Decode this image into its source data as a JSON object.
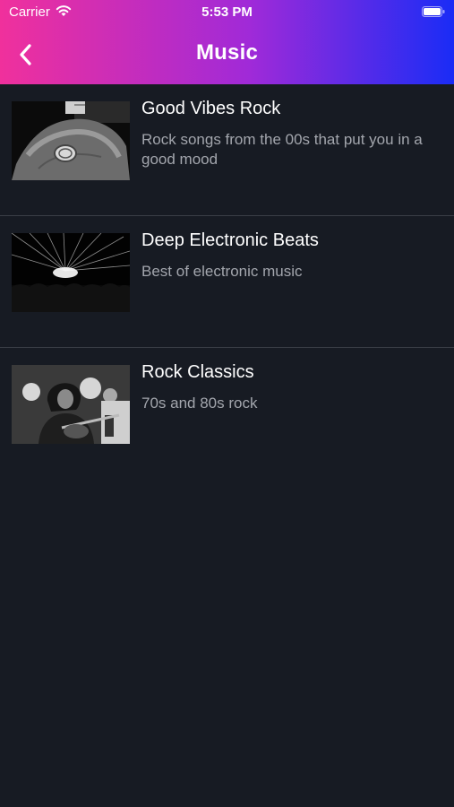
{
  "status_bar": {
    "carrier": "Carrier",
    "time": "5:53 PM"
  },
  "nav": {
    "title": "Music",
    "back_icon": "chevron-left-icon"
  },
  "colors": {
    "gradient_start": "#f0309c",
    "gradient_mid": "#a02ad8",
    "gradient_end": "#1a2cf6",
    "background": "#171b23",
    "divider": "#3a3e46",
    "secondary_text": "#a3a6ad"
  },
  "playlists": [
    {
      "title": "Good Vibes Rock",
      "description": "Rock songs from the 00s that put you in a good mood",
      "image": "hand-holding-coin-photo"
    },
    {
      "title": "Deep Electronic Beats",
      "description": "Best of electronic music",
      "image": "concert-light-beams-photo"
    },
    {
      "title": "Rock Classics",
      "description": "70s and 80s rock",
      "image": "rock-guitarist-singing-photo"
    }
  ]
}
